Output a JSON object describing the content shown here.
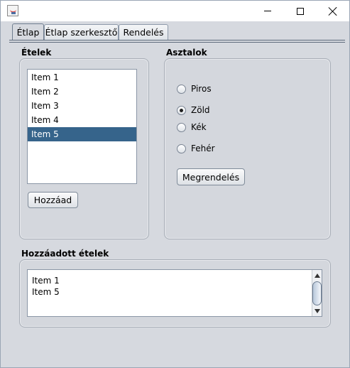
{
  "window": {
    "title": ""
  },
  "tabs": [
    {
      "label": "Étlap",
      "active": true
    },
    {
      "label": "Étlap szerkesztő",
      "active": false
    },
    {
      "label": "Rendelés",
      "active": false
    }
  ],
  "food_panel": {
    "title": "Ételek",
    "items": [
      "Item 1",
      "Item 2",
      "Item 3",
      "Item 4",
      "Item 5"
    ],
    "selected_item": "Item 5",
    "add_button_label": "Hozzáad"
  },
  "tables_panel": {
    "title": "Asztalok",
    "options": [
      {
        "label": "Piros",
        "checked": false
      },
      {
        "label": "Zöld",
        "checked": true
      },
      {
        "label": "Kék",
        "checked": false
      },
      {
        "label": "Fehér",
        "checked": false
      }
    ],
    "order_button_label": "Megrendelés"
  },
  "added_panel": {
    "title": "Hozzáadott ételek",
    "lines": [
      "Item 1",
      "Item 5"
    ]
  },
  "colors": {
    "selection": "#36648b",
    "panel_background": "#d4d7dd"
  },
  "icons": [
    "java-app-icon",
    "minimize-icon",
    "maximize-icon",
    "close-icon",
    "scroll-up-arrow-icon",
    "scroll-down-arrow-icon"
  ]
}
